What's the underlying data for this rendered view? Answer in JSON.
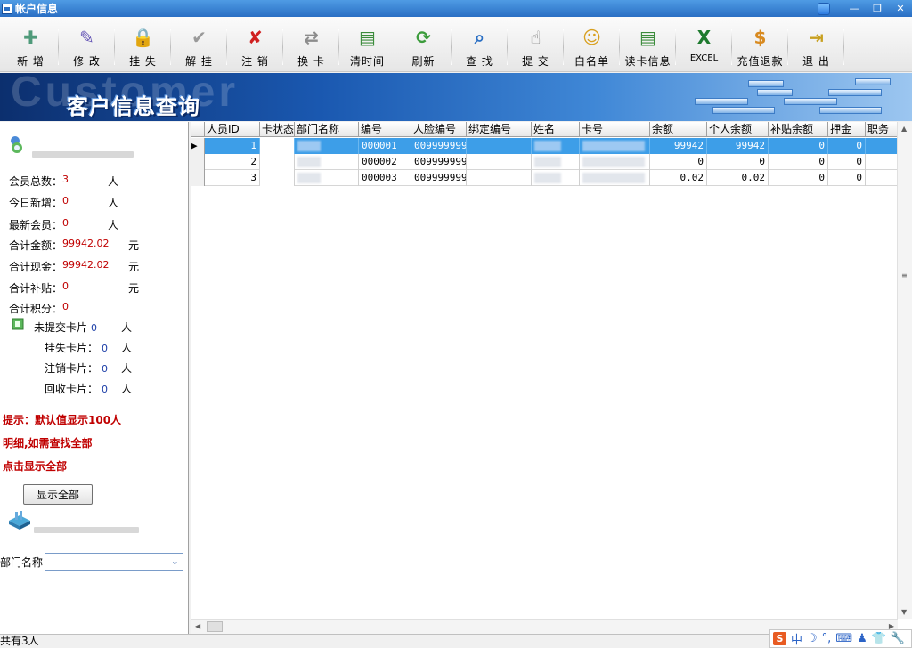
{
  "window": {
    "title": "帐户信息"
  },
  "toolbar": [
    {
      "name": "add",
      "label": "新 增",
      "icon": "add-user-icon",
      "glyph": "✚",
      "color": "#4f9a7a"
    },
    {
      "name": "edit",
      "label": "修 改",
      "icon": "edit-pen-icon",
      "glyph": "✎",
      "color": "#6a5bb8"
    },
    {
      "name": "report-loss",
      "label": "挂 失",
      "icon": "lock-icon",
      "glyph": "🔒",
      "color": "#c23030"
    },
    {
      "name": "unlock",
      "label": "解 挂",
      "icon": "check-icon",
      "glyph": "✔",
      "color": "#9a9a9a"
    },
    {
      "name": "cancel",
      "label": "注 销",
      "icon": "cancel-x-icon",
      "glyph": "✘",
      "color": "#d02020"
    },
    {
      "name": "swap-card",
      "label": "换 卡",
      "icon": "swap-card-icon",
      "glyph": "⇄",
      "color": "#8c8c8c"
    },
    {
      "name": "clear-time",
      "label": "清时间",
      "icon": "document-icon",
      "glyph": "▤",
      "color": "#3c8c3c"
    },
    {
      "name": "refresh",
      "label": "刷新",
      "icon": "refresh-icon",
      "glyph": "⟳",
      "color": "#3c9c3c"
    },
    {
      "name": "search",
      "label": "查 找",
      "icon": "search-icon",
      "glyph": "⌕",
      "color": "#2a6fc4"
    },
    {
      "name": "submit",
      "label": "提 交",
      "icon": "submit-user-icon",
      "glyph": "☝",
      "color": "#8a8a8a"
    },
    {
      "name": "whitelist",
      "label": "白名单",
      "icon": "users-icon",
      "glyph": "☺",
      "color": "#d8a020"
    },
    {
      "name": "read-card",
      "label": "读卡信息",
      "icon": "read-card-icon",
      "glyph": "▤",
      "color": "#3c8c3c"
    },
    {
      "name": "excel",
      "label": "EXCEL",
      "icon": "excel-icon",
      "glyph": "X",
      "color": "#1e7a2e"
    },
    {
      "name": "recharge-refund",
      "label": "充值退款",
      "icon": "money-icon",
      "glyph": "$",
      "color": "#d88a20"
    },
    {
      "name": "exit",
      "label": "退 出",
      "icon": "exit-icon",
      "glyph": "⇥",
      "color": "#c8a020"
    }
  ],
  "banner": {
    "title": "客户信息查询",
    "ghost_text": "Customer"
  },
  "summary": {
    "member_total": {
      "label": "会员总数：",
      "value": "3",
      "unit": "人"
    },
    "today_new": {
      "label": "今日新增：",
      "value": "0",
      "unit": "人"
    },
    "latest_member": {
      "label": "最新会员：",
      "value": "0",
      "unit": "人"
    },
    "total_amount": {
      "label": "合计金额：",
      "value": "99942.02",
      "unit": "元"
    },
    "total_cash": {
      "label": "合计现金：",
      "value": "99942.02",
      "unit": "元"
    },
    "total_subsidy": {
      "label": "合计补贴：",
      "value": "0",
      "unit": "元"
    },
    "total_points": {
      "label": "合计积分：",
      "value": "0"
    }
  },
  "cards": {
    "unsubmitted": {
      "label": "未提交卡片",
      "value": "0",
      "unit": "人"
    },
    "lost": {
      "label": "挂失卡片：",
      "value": "0",
      "unit": "人"
    },
    "cancelled": {
      "label": "注销卡片：",
      "value": "0",
      "unit": "人"
    },
    "recycled": {
      "label": "回收卡片：",
      "value": "0",
      "unit": "人"
    }
  },
  "tip": [
    "提示：默认值显示100人",
    "明细,如需查找全部",
    "点击显示全部"
  ],
  "show_all_label": "显示全部",
  "dept_filter": {
    "label": "部门名称",
    "value": ""
  },
  "grid": {
    "columns": [
      "人员ID",
      "卡状态",
      "部门名称",
      "编号",
      "人脸编号",
      "绑定编号",
      "姓名",
      "卡号",
      "余额",
      "个人余额",
      "补贴余额",
      "押金",
      "职务"
    ],
    "rows": [
      {
        "id": "1",
        "card_status": "",
        "dept": "",
        "code": "000001",
        "face_code": "009999999",
        "bind_code": "",
        "name": "",
        "card_no": "",
        "balance": "99942",
        "personal_balance": "99942",
        "subsidy_balance": "0",
        "deposit": "0",
        "position": ""
      },
      {
        "id": "2",
        "card_status": "",
        "dept": "",
        "code": "000002",
        "face_code": "009999999",
        "bind_code": "",
        "name": "",
        "card_no": "",
        "balance": "0",
        "personal_balance": "0",
        "subsidy_balance": "0",
        "deposit": "0",
        "position": ""
      },
      {
        "id": "3",
        "card_status": "",
        "dept": "",
        "code": "000003",
        "face_code": "009999999",
        "bind_code": "",
        "name": "",
        "card_no": "",
        "balance": "0.02",
        "personal_balance": "0.02",
        "subsidy_balance": "0",
        "deposit": "0",
        "position": ""
      }
    ]
  },
  "status": {
    "text": "共有3人"
  },
  "ime": {
    "items": [
      "中",
      "☽",
      "°,",
      "⌨",
      "♟",
      "👕",
      "🔧"
    ]
  }
}
